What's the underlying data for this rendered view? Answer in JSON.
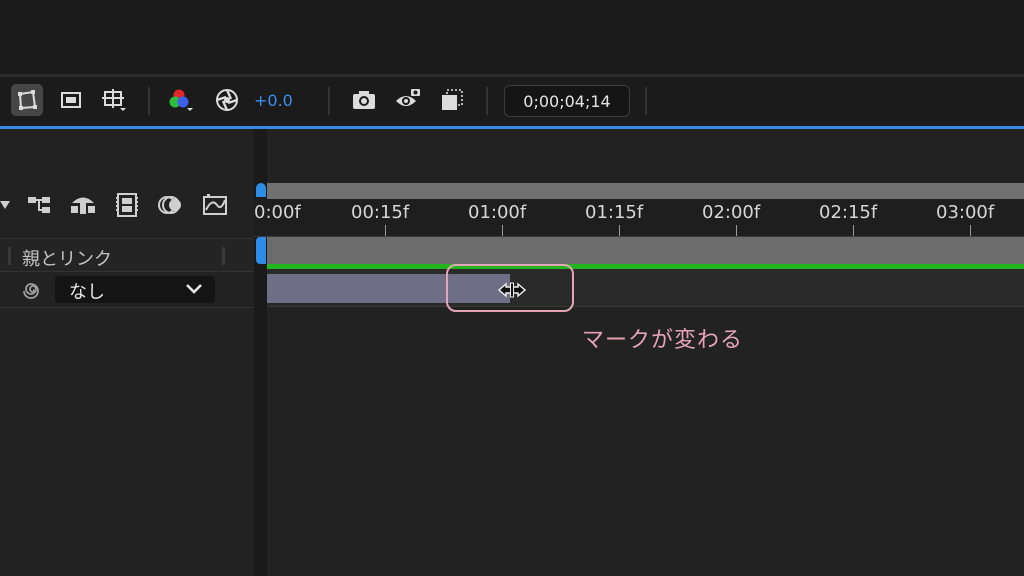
{
  "toolbar": {
    "exposure_value": "+0.0",
    "timecode": "0;00;04;14"
  },
  "layer_panel": {
    "parent_column_label": "親とリンク",
    "parent_value": "なし"
  },
  "timeline": {
    "ruler_labels": [
      "0:00f",
      "00:15f",
      "01:00f",
      "01:15f",
      "02:00f",
      "02:15f",
      "03:00f"
    ]
  },
  "annotation": {
    "text": "マークが変わる"
  },
  "colors": {
    "accent_blue": "#3b8ae6",
    "work_area_green": "#22b51f",
    "layer_bar": "#6e6f86",
    "annotation_pink": "#e7a2b7"
  }
}
